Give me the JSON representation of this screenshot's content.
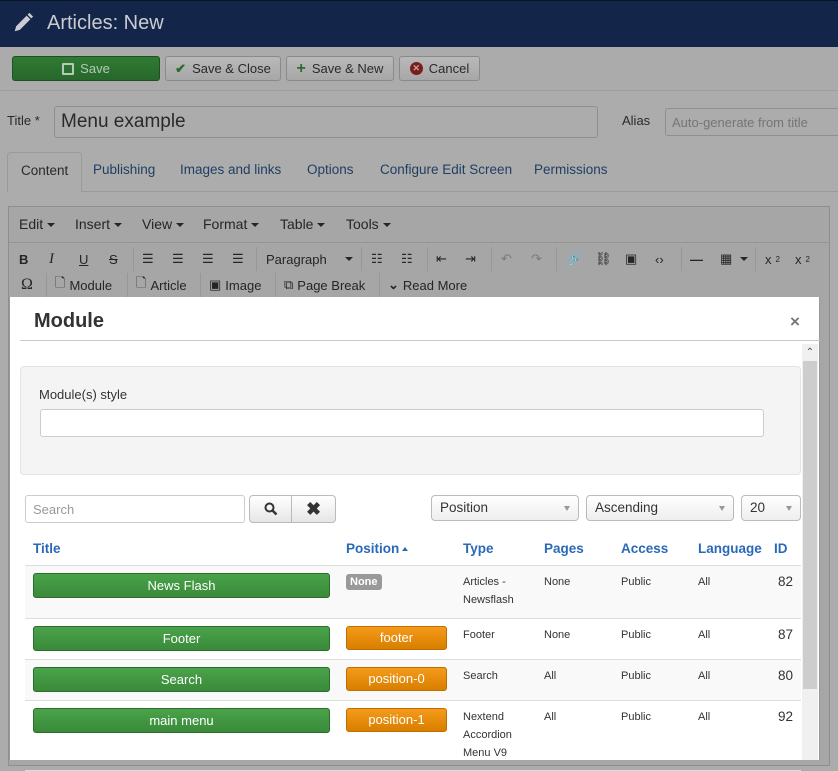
{
  "header": {
    "title": "Articles: New",
    "icon": "pencil-icon"
  },
  "toolbar": {
    "save": "Save",
    "save_close": "Save & Close",
    "save_new": "Save & New",
    "cancel": "Cancel"
  },
  "form": {
    "title_label": "Title *",
    "title_value": "Menu example",
    "alias_label": "Alias",
    "alias_placeholder": "Auto-generate from title"
  },
  "tabs": [
    {
      "label": "Content",
      "active": true
    },
    {
      "label": "Publishing"
    },
    {
      "label": "Images and links"
    },
    {
      "label": "Options"
    },
    {
      "label": "Configure Edit Screen"
    },
    {
      "label": "Permissions"
    }
  ],
  "editor": {
    "menus": [
      "Edit",
      "Insert",
      "View",
      "Format",
      "Table",
      "Tools"
    ],
    "format_select": "Paragraph",
    "buttons_row2": {
      "module": "Module",
      "article": "Article",
      "image": "Image",
      "page_break": "Page Break",
      "read_more": "Read More"
    }
  },
  "modal": {
    "title": "Module",
    "close": "×",
    "style_label": "Module(s) style",
    "style_value": "",
    "search_placeholder": "Search",
    "sort_field": "Position",
    "sort_direction": "Ascending",
    "limit": "20",
    "columns": [
      "Title",
      "Position",
      "Type",
      "Pages",
      "Access",
      "Language",
      "ID"
    ],
    "rows": [
      {
        "title": "News Flash",
        "position": "None",
        "position_none": true,
        "type": "Articles - Newsflash",
        "pages": "None",
        "access": "Public",
        "language": "All",
        "id": "82"
      },
      {
        "title": "Footer",
        "position": "footer",
        "type": "Footer",
        "pages": "None",
        "access": "Public",
        "language": "All",
        "id": "87"
      },
      {
        "title": "Search",
        "position": "position-0",
        "type": "Search",
        "pages": "All",
        "access": "Public",
        "language": "All",
        "id": "80"
      },
      {
        "title": "main menu",
        "position": "position-1",
        "type": "Nextend Accordion Menu V9",
        "pages": "All",
        "access": "Public",
        "language": "All",
        "id": "92"
      }
    ]
  }
}
